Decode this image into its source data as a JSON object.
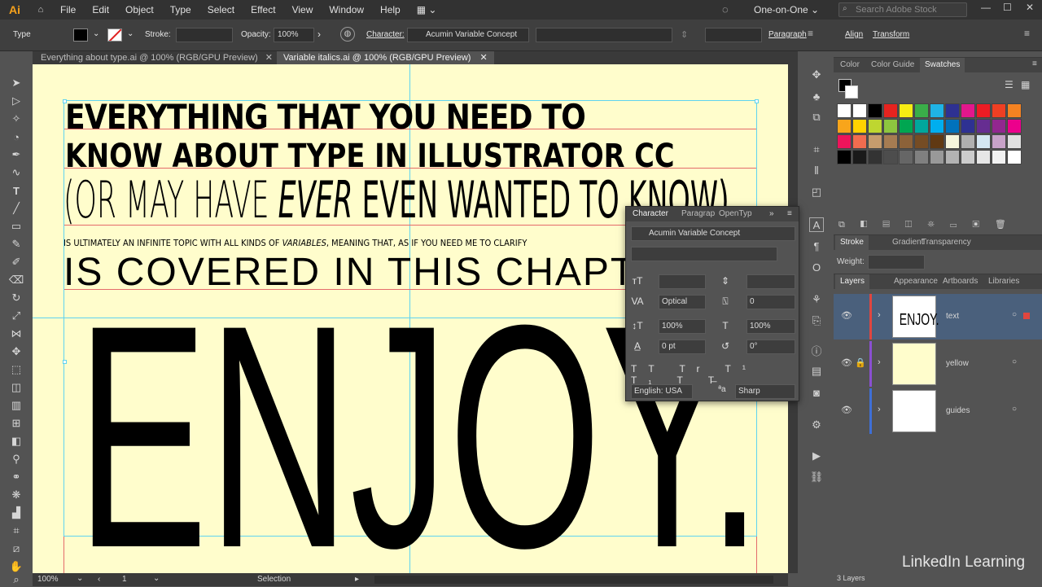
{
  "app": {
    "logo": "Ai"
  },
  "menu": [
    "File",
    "Edit",
    "Object",
    "Type",
    "Select",
    "Effect",
    "View",
    "Window",
    "Help"
  ],
  "workspace": "One-on-One",
  "search_placeholder": "Search Adobe Stock",
  "control": {
    "type_label": "Type",
    "stroke_label": "Stroke:",
    "opacity_label": "Opacity:",
    "opacity_value": "100%",
    "character_label": "Character:",
    "font": "Acumin Variable Concept",
    "paragraph_label": "Paragraph",
    "align_label": "Align",
    "transform_label": "Transform"
  },
  "tabs": [
    {
      "label": "Everything about type.ai @ 100% (RGB/GPU Preview)"
    },
    {
      "label": "Variable italics.ai @ 100% (RGB/GPU Preview)"
    }
  ],
  "art": {
    "line1": "EVERYTHING THAT YOU NEED TO",
    "line2": "KNOW ABOUT TYPE IN ILLUSTRATOR CC",
    "line3a": "(OR MAY HAVE ",
    "line3b": "EVER",
    "line3c": " EVEN WANTED ",
    "line3d": "TO KNOW)",
    "line4a": "IS ULTIMATELY AN INFINITE TOPIC WITH ALL KINDS OF ",
    "line4b": "VARIABLES",
    "line4c": ", MEANING THAT, AS IF YOU NEED ME TO CLARIFY",
    "line5": "IS COVERED IN THIS CHAPTER",
    "line6": "ENJOY."
  },
  "status": {
    "zoom": "100%",
    "artboard": "1",
    "tool": "Selection"
  },
  "character_panel": {
    "tabs": [
      "Character",
      "Paragrap",
      "OpenTyp"
    ],
    "font": "Acumin Variable Concept",
    "kerning": "Optical",
    "tracking": "0",
    "vscale": "100%",
    "hscale": "100%",
    "baseline": "0 pt",
    "rotation": "0°",
    "language": "English: USA",
    "antialias": "Sharp"
  },
  "swatches_panel": {
    "tabs": [
      "Color",
      "Color Guide",
      "Swatches"
    ]
  },
  "stroke_panel": {
    "tabs": [
      "Stroke",
      "Gradient",
      "Transparency"
    ],
    "weight_label": "Weight:"
  },
  "layers_panel": {
    "tabs": [
      "Layers",
      "Appearance",
      "Artboards",
      "Libraries"
    ],
    "layers": [
      {
        "name": "text",
        "color": "#e0463f"
      },
      {
        "name": "yellow",
        "color": "#8a4fd1"
      },
      {
        "name": "guides",
        "color": "#3e6fd6"
      }
    ],
    "footer": "3 Layers"
  },
  "watermark": "LinkedIn Learning"
}
